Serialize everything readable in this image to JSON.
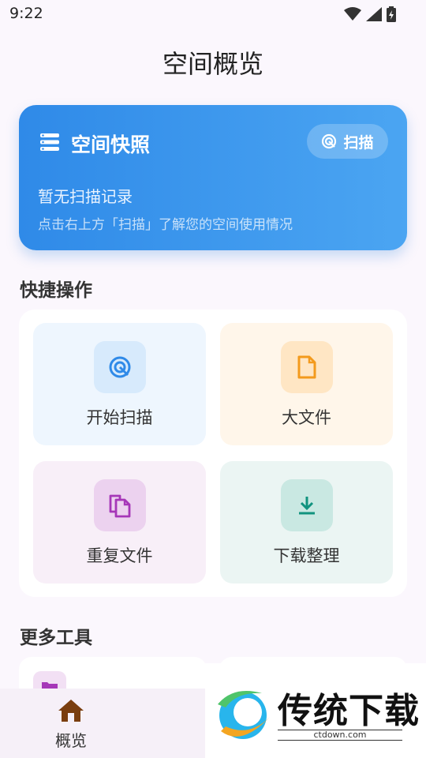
{
  "status_bar": {
    "time": "9:22"
  },
  "page": {
    "title": "空间概览"
  },
  "snapshot": {
    "title": "空间快照",
    "scan_label": "扫描",
    "status": "暂无扫描记录",
    "hint": "点击右上方「扫描」了解您的空间使用情况"
  },
  "quick_actions": {
    "title": "快捷操作",
    "items": [
      {
        "label": "开始扫描",
        "icon": "scan-target-icon",
        "color": "#2f8ae8",
        "bg": "#eef6fe",
        "icon_bg": "#d7eafc"
      },
      {
        "label": "大文件",
        "icon": "file-icon",
        "color": "#f39a1d",
        "bg": "#fff6ea",
        "icon_bg": "#ffe6c4"
      },
      {
        "label": "重复文件",
        "icon": "copy-files-icon",
        "color": "#a637b8",
        "bg": "#f8eff8",
        "icon_bg": "#ecd2ef"
      },
      {
        "label": "下载整理",
        "icon": "download-icon",
        "color": "#11937f",
        "bg": "#ebf5f3",
        "icon_bg": "#c9e8e2"
      }
    ]
  },
  "more_tools": {
    "title": "更多工具"
  },
  "bottom_nav": {
    "items": [
      {
        "label": "概览",
        "icon": "home-icon"
      }
    ]
  },
  "watermark": {
    "text": "传统下载",
    "url": "ctdown.com"
  }
}
